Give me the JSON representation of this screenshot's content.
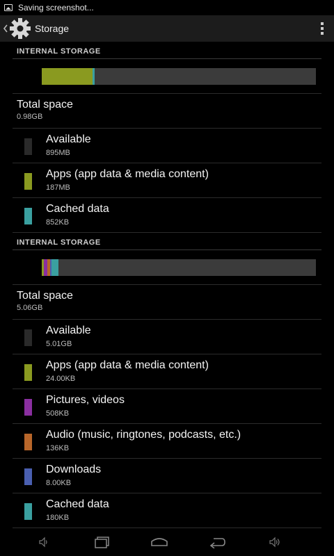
{
  "status_bar": {
    "notification_text": "Saving screenshot..."
  },
  "action_bar": {
    "title": "Storage"
  },
  "sections": [
    {
      "header": "INTERNAL STORAGE",
      "usage_fractions": [
        {
          "color": "#8a9a20",
          "fraction": 0.186
        },
        {
          "color": "#3aa0a0",
          "fraction": 0.008
        }
      ],
      "total": {
        "label": "Total space",
        "value": "0.98GB"
      },
      "items": [
        {
          "label": "Available",
          "value": "895MB",
          "color": "#2a2a2a"
        },
        {
          "label": "Apps (app data & media content)",
          "value": "187MB",
          "color": "#8a9a20"
        },
        {
          "label": "Cached data",
          "value": "852KB",
          "color": "#3aa0a0"
        }
      ]
    },
    {
      "header": "INTERNAL STORAGE",
      "usage_fractions": [
        {
          "color": "#8a9a20",
          "fraction": 0.008
        },
        {
          "color": "#8a2fa0",
          "fraction": 0.012
        },
        {
          "color": "#b8662a",
          "fraction": 0.01
        },
        {
          "color": "#4a5fb0",
          "fraction": 0.006
        },
        {
          "color": "#3aa0a0",
          "fraction": 0.026
        }
      ],
      "total": {
        "label": "Total space",
        "value": "5.06GB"
      },
      "items": [
        {
          "label": "Available",
          "value": "5.01GB",
          "color": "#2a2a2a"
        },
        {
          "label": "Apps (app data & media content)",
          "value": "24.00KB",
          "color": "#8a9a20"
        },
        {
          "label": "Pictures, videos",
          "value": "508KB",
          "color": "#8a2fa0"
        },
        {
          "label": "Audio (music, ringtones, podcasts, etc.)",
          "value": "136KB",
          "color": "#b8662a"
        },
        {
          "label": "Downloads",
          "value": "8.00KB",
          "color": "#4a5fb0"
        },
        {
          "label": "Cached data",
          "value": "180KB",
          "color": "#3aa0a0"
        }
      ]
    }
  ],
  "nav_bar": {
    "icons": [
      "volume-down-icon",
      "recent-apps-icon",
      "home-icon",
      "back-icon",
      "volume-up-icon"
    ]
  }
}
